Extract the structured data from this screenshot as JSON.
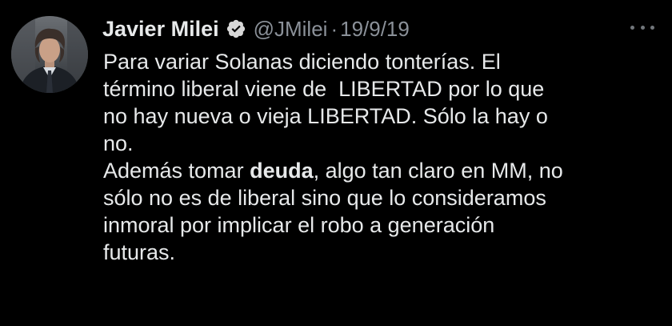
{
  "author": {
    "name": "Javier Milei",
    "handle": "@JMilei",
    "separator": "·",
    "date": "19/9/19",
    "verified": true,
    "avatar_icon": "profile-photo-icon"
  },
  "more_icon": "more-options-icon",
  "colors": {
    "background": "#000000",
    "text": "#e7e9ea",
    "secondary_text": "#8b9199",
    "verified_badge": "#d8d8d8"
  },
  "tweet": {
    "lines": [
      "Para variar Solanas diciendo tonterías. El",
      "término liberal viene de  LIBERTAD por lo que",
      "no hay nueva o vieja LIBERTAD. Sólo la hay o",
      "no."
    ],
    "line5_before": "Además tomar ",
    "line5_bold": "deuda",
    "line5_after": ", algo tan claro en MM, no",
    "lines_after": [
      "sólo no es de liberal sino que lo consideramos",
      "inmoral por implicar el robo a generación",
      "futuras."
    ]
  }
}
